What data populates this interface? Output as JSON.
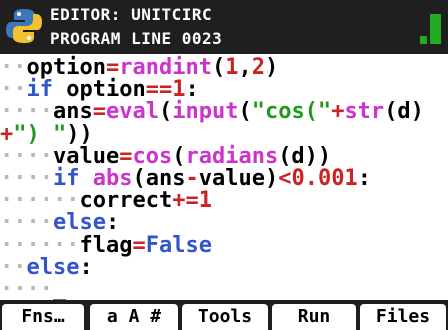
{
  "title": {
    "line1": "EDITOR: UNITCIRC",
    "line2": "PROGRAM LINE 0023"
  },
  "colors": {
    "background": "#ffffff",
    "titlebar": "#1f1f1f",
    "keyword": "#3355cc",
    "function": "#cc33cc",
    "number": "#cc2222",
    "string": "#229922",
    "indent_dots": "#b8b8b8",
    "battery": "#22aa22"
  },
  "code": {
    "lines": [
      {
        "indent": "··",
        "tokens": [
          [
            "txt",
            "option"
          ],
          [
            "op",
            "="
          ],
          [
            "fn",
            "randint"
          ],
          [
            "txt",
            "("
          ],
          [
            "num",
            "1"
          ],
          [
            "txt",
            ","
          ],
          [
            "num",
            "2"
          ],
          [
            "txt",
            ")"
          ]
        ]
      },
      {
        "indent": "··",
        "tokens": [
          [
            "kw",
            "if"
          ],
          [
            "txt",
            " option"
          ],
          [
            "op",
            "=="
          ],
          [
            "num",
            "1"
          ],
          [
            "txt",
            ":"
          ]
        ]
      },
      {
        "indent": "····",
        "tokens": [
          [
            "txt",
            "ans"
          ],
          [
            "op",
            "="
          ],
          [
            "fn",
            "eval"
          ],
          [
            "txt",
            "("
          ],
          [
            "fn",
            "input"
          ],
          [
            "txt",
            "("
          ],
          [
            "str",
            "\"cos(\""
          ],
          [
            "op",
            "+"
          ],
          [
            "fn",
            "str"
          ],
          [
            "txt",
            "(d)"
          ]
        ]
      },
      {
        "indent": "     ",
        "tokens": [
          [
            "op",
            "+"
          ],
          [
            "str",
            "\") \""
          ],
          [
            "txt",
            "))"
          ]
        ]
      },
      {
        "indent": "····",
        "tokens": [
          [
            "txt",
            "value"
          ],
          [
            "op",
            "="
          ],
          [
            "fn",
            "cos"
          ],
          [
            "txt",
            "("
          ],
          [
            "fn",
            "radians"
          ],
          [
            "txt",
            "(d))"
          ]
        ]
      },
      {
        "indent": "····",
        "tokens": [
          [
            "kw",
            "if"
          ],
          [
            "txt",
            " "
          ],
          [
            "fn",
            "abs"
          ],
          [
            "txt",
            "(ans"
          ],
          [
            "op",
            "-"
          ],
          [
            "txt",
            "value)"
          ],
          [
            "op",
            "<"
          ],
          [
            "num",
            "0.001"
          ],
          [
            "txt",
            ":"
          ]
        ]
      },
      {
        "indent": "······",
        "tokens": [
          [
            "txt",
            "correct"
          ],
          [
            "op",
            "+="
          ],
          [
            "num",
            "1"
          ]
        ]
      },
      {
        "indent": "····",
        "tokens": [
          [
            "kw",
            "else"
          ],
          [
            "txt",
            ":"
          ]
        ]
      },
      {
        "indent": "······",
        "tokens": [
          [
            "txt",
            "flag"
          ],
          [
            "op",
            "="
          ],
          [
            "kw",
            "False"
          ]
        ]
      },
      {
        "indent": "··",
        "tokens": [
          [
            "kw",
            "else"
          ],
          [
            "txt",
            ":"
          ]
        ]
      },
      {
        "indent": "····",
        "tokens": [
          [
            "txt",
            "_"
          ]
        ]
      }
    ]
  },
  "menu": {
    "items": [
      "Fns…",
      "a A #",
      "Tools",
      "Run",
      "Files"
    ]
  },
  "icons": {
    "logo": "python-logo-icon",
    "battery": "battery-icon"
  }
}
